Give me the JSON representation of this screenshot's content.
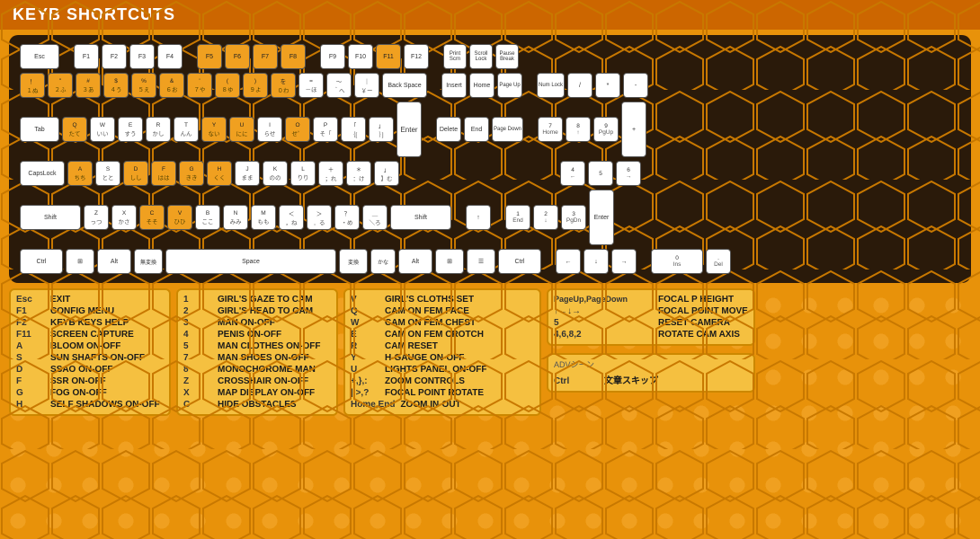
{
  "title": "KEYB SHORTCUTS",
  "keyboard": {
    "rows": [
      {
        "keys": [
          {
            "label": "Esc",
            "style": "white wide-1-5"
          },
          {
            "gap": true
          },
          {
            "label": "F1",
            "style": "white"
          },
          {
            "label": "F2",
            "style": "white"
          },
          {
            "label": "F3",
            "style": "white"
          },
          {
            "label": "F4",
            "style": "white"
          },
          {
            "gap": true
          },
          {
            "label": "F5",
            "style": "orange"
          },
          {
            "label": "F6",
            "style": "orange"
          },
          {
            "label": "F7",
            "style": "orange"
          },
          {
            "label": "F8",
            "style": "orange"
          },
          {
            "gap": true
          },
          {
            "label": "F9",
            "style": "white"
          },
          {
            "label": "F10",
            "style": "white"
          },
          {
            "label": "F11",
            "style": "orange"
          },
          {
            "label": "F12",
            "style": "white"
          },
          {
            "gap": true
          },
          {
            "label": "Print\nScrn",
            "style": "white key-small"
          },
          {
            "label": "Scroll\nLock",
            "style": "white key-small"
          },
          {
            "label": "Pause\nBreak",
            "style": "white key-small"
          }
        ]
      }
    ]
  },
  "panels": {
    "left": {
      "rows": [
        {
          "key": "Esc",
          "label": "EXIT"
        },
        {
          "key": "F1",
          "label": "CONFIG MENU"
        },
        {
          "key": "F2",
          "label": "KEYB KEYS HELP"
        },
        {
          "key": "F11",
          "label": "SCREEN CAPTURE"
        },
        {
          "key": "A",
          "label": "BLOOM ON-OFF"
        },
        {
          "key": "S",
          "label": "SUN SHAFTS ON-OFF"
        },
        {
          "key": "D",
          "label": "SSAO ON-OFF"
        },
        {
          "key": "F",
          "label": "SSR ON-OFF"
        },
        {
          "key": "G",
          "label": "FOG ON-OFF"
        },
        {
          "key": "H",
          "label": "SELF SHADOWS ON-OFF"
        }
      ]
    },
    "middle": {
      "rows": [
        {
          "key": "1",
          "label": "GIRL'S GAZE TO CAM"
        },
        {
          "key": "2",
          "label": "GIRL'S HEAD TO CAM"
        },
        {
          "key": "3",
          "label": "MAN ON-OFF"
        },
        {
          "key": "4",
          "label": "PENIS ON-OFF"
        },
        {
          "key": "5",
          "label": "MAN CLOTHES ON-OFF"
        },
        {
          "key": "7",
          "label": "MAN SHOES ON-OFF"
        },
        {
          "key": "8",
          "label": "MONOCHOROME MAN"
        },
        {
          "key": "Z",
          "label": "CROSSHAIR ON-OFF"
        },
        {
          "key": "X",
          "label": "MAP DISPLAY ON-OFF"
        },
        {
          "key": "C",
          "label": "HIDE OBSTACLES"
        }
      ]
    },
    "right": {
      "rows": [
        {
          "key": "V",
          "label": "GIRL'S CLOTHS SET"
        },
        {
          "key": "Q",
          "label": "CAM ON FEM FACE"
        },
        {
          "key": "W",
          "label": "CAM ON FEM CHEST"
        },
        {
          "key": "E",
          "label": "CAM ON FEM CROTCH"
        },
        {
          "key": "R",
          "label": "CAM RESET"
        },
        {
          "key": "Y",
          "label": "H-GAUGE ON-OFF"
        },
        {
          "key": "U",
          "label": "LIGHTS PANEL ON-OFF"
        },
        {
          "key": "+,},:",
          "label": "ZOOM CONTROLS"
        },
        {
          "key": "|,>,?",
          "label": "FOCAL POINT ROTATE"
        },
        {
          "key": "Home,End",
          "label": "ZOOM IN-OUT"
        }
      ]
    },
    "far_right": {
      "rows": [
        {
          "key": "PageUp,PageDown",
          "label": "FOCAL P HEIGHT"
        },
        {
          "key": "↑←↓→",
          "label": "FOCAL POINT MOVE"
        },
        {
          "key": "5",
          "label": "RESET CAMERA"
        },
        {
          "key": "4,6,8,2",
          "label": "ROTATE CAM AXIS"
        }
      ],
      "adv": {
        "title": "ADVシーン",
        "rows": [
          {
            "key": "Ctrl",
            "label": "文章スキップ"
          }
        ]
      }
    }
  }
}
